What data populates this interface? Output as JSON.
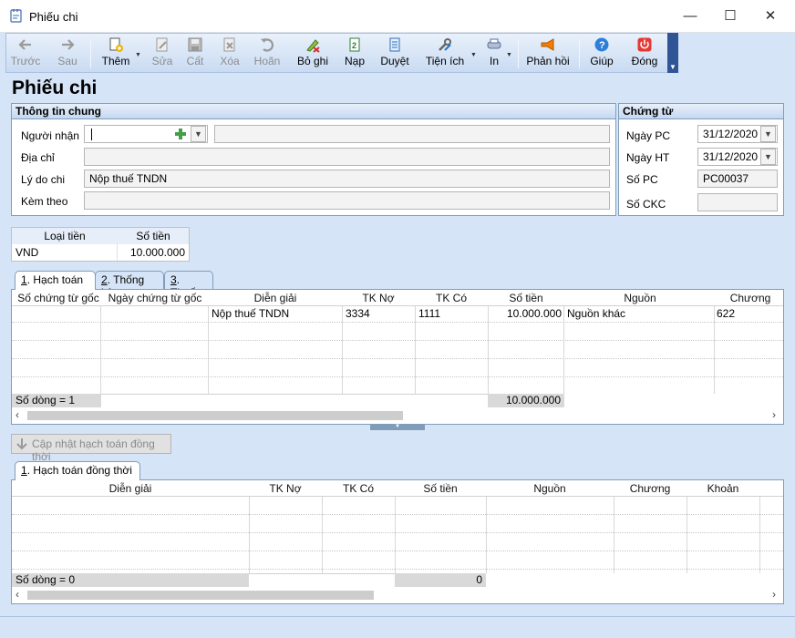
{
  "window": {
    "title": "Phiếu chi",
    "minimize": "—",
    "maximize": "☐",
    "close": "✕"
  },
  "toolbar": {
    "items": [
      {
        "name": "back",
        "label": "Trước",
        "icon": "arrow-left-icon",
        "enabled": false
      },
      {
        "name": "forward",
        "label": "Sau",
        "icon": "arrow-right-icon",
        "enabled": false
      },
      {
        "name": "add",
        "label": "Thêm",
        "icon": "add-doc-icon",
        "enabled": true
      },
      {
        "name": "edit",
        "label": "Sửa",
        "icon": "edit-doc-icon",
        "enabled": false
      },
      {
        "name": "save",
        "label": "Cất",
        "icon": "save-icon",
        "enabled": false
      },
      {
        "name": "delete",
        "label": "Xóa",
        "icon": "delete-doc-icon",
        "enabled": false
      },
      {
        "name": "undo",
        "label": "Hoãn",
        "icon": "undo-icon",
        "enabled": false
      },
      {
        "name": "unpost",
        "label": "Bỏ ghi",
        "icon": "unpost-icon",
        "enabled": true
      },
      {
        "name": "reload",
        "label": "Nạp",
        "icon": "reload-icon",
        "enabled": true
      },
      {
        "name": "browse",
        "label": "Duyệt",
        "icon": "browse-icon",
        "enabled": true
      },
      {
        "name": "utilities",
        "label": "Tiện ích",
        "icon": "tools-icon",
        "enabled": true
      },
      {
        "name": "print",
        "label": "In",
        "icon": "printer-icon",
        "enabled": true
      },
      {
        "name": "feedback",
        "label": "Phản hồi",
        "icon": "megaphone-icon",
        "enabled": true
      },
      {
        "name": "help",
        "label": "Giúp",
        "icon": "help-icon",
        "enabled": true
      },
      {
        "name": "close",
        "label": "Đóng",
        "icon": "power-icon",
        "enabled": true
      }
    ]
  },
  "page_title": "Phiếu chi",
  "general_info": {
    "header": "Thông tin chung",
    "recipient_label": "Người nhận",
    "recipient_value": "",
    "recipient_name": "",
    "address_label": "Địa chỉ",
    "address_value": "",
    "reason_label": "Lý do chi",
    "reason_value": "Nộp thuế TNDN",
    "attached_label": "Kèm theo",
    "attached_value": ""
  },
  "voucher": {
    "header": "Chứng từ",
    "date_pc_label": "Ngày PC",
    "date_pc_value": "31/12/2020",
    "date_ht_label": "Ngày HT",
    "date_ht_value": "31/12/2020",
    "number_label": "Số PC",
    "number_value": "PC00037",
    "ckc_label": "Số CKC",
    "ckc_value": ""
  },
  "money": {
    "currency_header": "Loại tiền",
    "amount_header": "Số tiền",
    "currency": "VND",
    "amount": "10.000.000"
  },
  "tabs_top": [
    {
      "key": "1",
      "label": ". Hạch toán"
    },
    {
      "key": "2",
      "label": ". Thống kê"
    },
    {
      "key": "3",
      "label": ". Thuế"
    }
  ],
  "grid1": {
    "columns": [
      "Số chứng từ gốc",
      "Ngày chứng từ gốc",
      "Diễn giải",
      "TK Nợ",
      "TK Có",
      "Số tiền",
      "Nguồn",
      "Chương"
    ],
    "rows": [
      {
        "desc": "Nộp thuế TNDN",
        "debit": "3334",
        "credit": "1111",
        "amount": "10.000.000",
        "source": "Nguồn khác",
        "chapter": "622"
      }
    ],
    "footer_count": "Số dòng = 1",
    "footer_total": "10.000.000"
  },
  "update_button": "Cập nhật hạch toán đồng thời",
  "tabs_bottom": [
    {
      "key": "1",
      "label": ". Hạch toán đồng thời"
    }
  ],
  "grid2": {
    "columns": [
      "Diễn giải",
      "TK Nợ",
      "TK Có",
      "Số tiền",
      "Nguồn",
      "Chương",
      "Khoản"
    ],
    "footer_count": "Số dòng = 0",
    "footer_total": "0"
  },
  "colors": {
    "accent": "#2f5597",
    "panel": "#d6e4f7",
    "border": "#7f9db9"
  }
}
